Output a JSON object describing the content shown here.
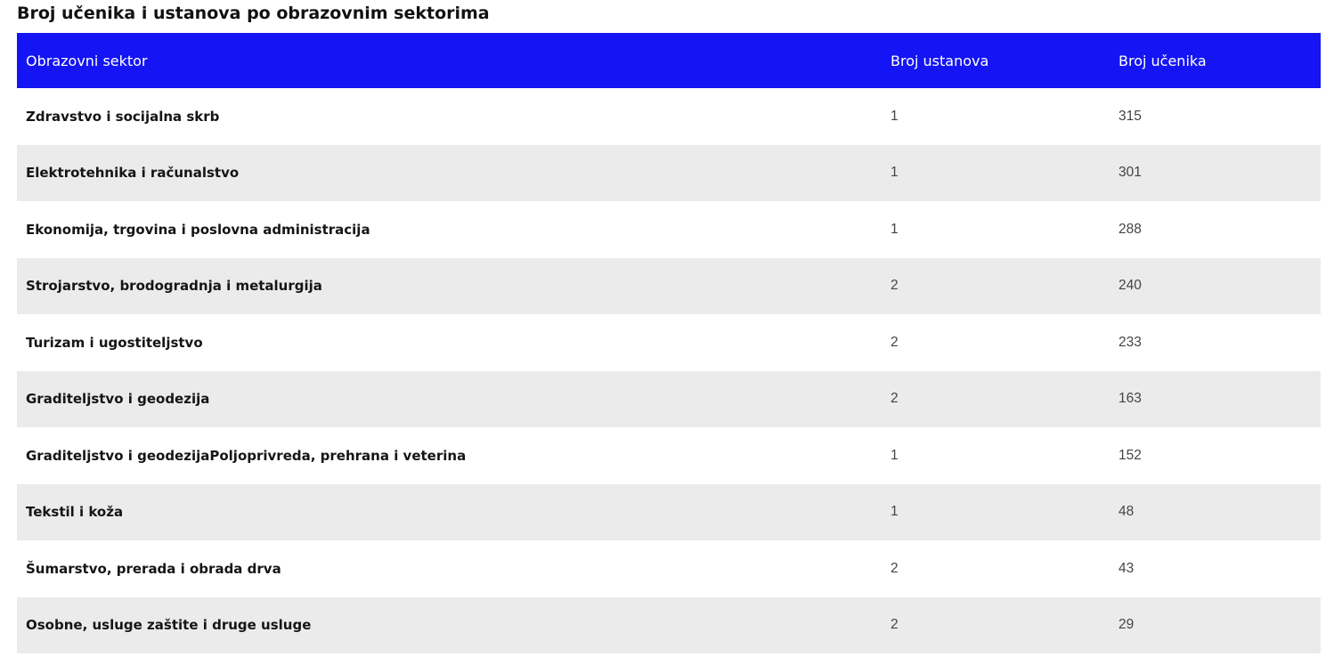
{
  "page": {
    "title": "Broj učenika i ustanova po obrazovnim sektorima"
  },
  "table": {
    "headers": [
      "Obrazovni sektor",
      "Broj ustanova",
      "Broj učenika"
    ],
    "rows": [
      {
        "sector": "Zdravstvo i socijalna skrb",
        "institutions": "1",
        "students": "315"
      },
      {
        "sector": "Elektrotehnika i računalstvo",
        "institutions": "1",
        "students": "301"
      },
      {
        "sector": "Ekonomija, trgovina i poslovna administracija",
        "institutions": "1",
        "students": "288"
      },
      {
        "sector": "Strojarstvo, brodogradnja i metalurgija",
        "institutions": "2",
        "students": "240"
      },
      {
        "sector": "Turizam i ugostiteljstvo",
        "institutions": "2",
        "students": "233"
      },
      {
        "sector": "Graditeljstvo i geodezija",
        "institutions": "2",
        "students": "163"
      },
      {
        "sector": "Graditeljstvo i geodezijaPoljoprivreda, prehrana i veterina",
        "institutions": "1",
        "students": "152"
      },
      {
        "sector": "Tekstil i koža",
        "institutions": "1",
        "students": "48"
      },
      {
        "sector": "Šumarstvo, prerada i obrada drva",
        "institutions": "2",
        "students": "43"
      },
      {
        "sector": "Osobne, usluge zaštite i druge usluge",
        "institutions": "2",
        "students": "29"
      }
    ]
  },
  "colors": {
    "header_bg": "#1414f5",
    "header_text": "#ffffff",
    "stripe_bg": "#ebebeb"
  }
}
